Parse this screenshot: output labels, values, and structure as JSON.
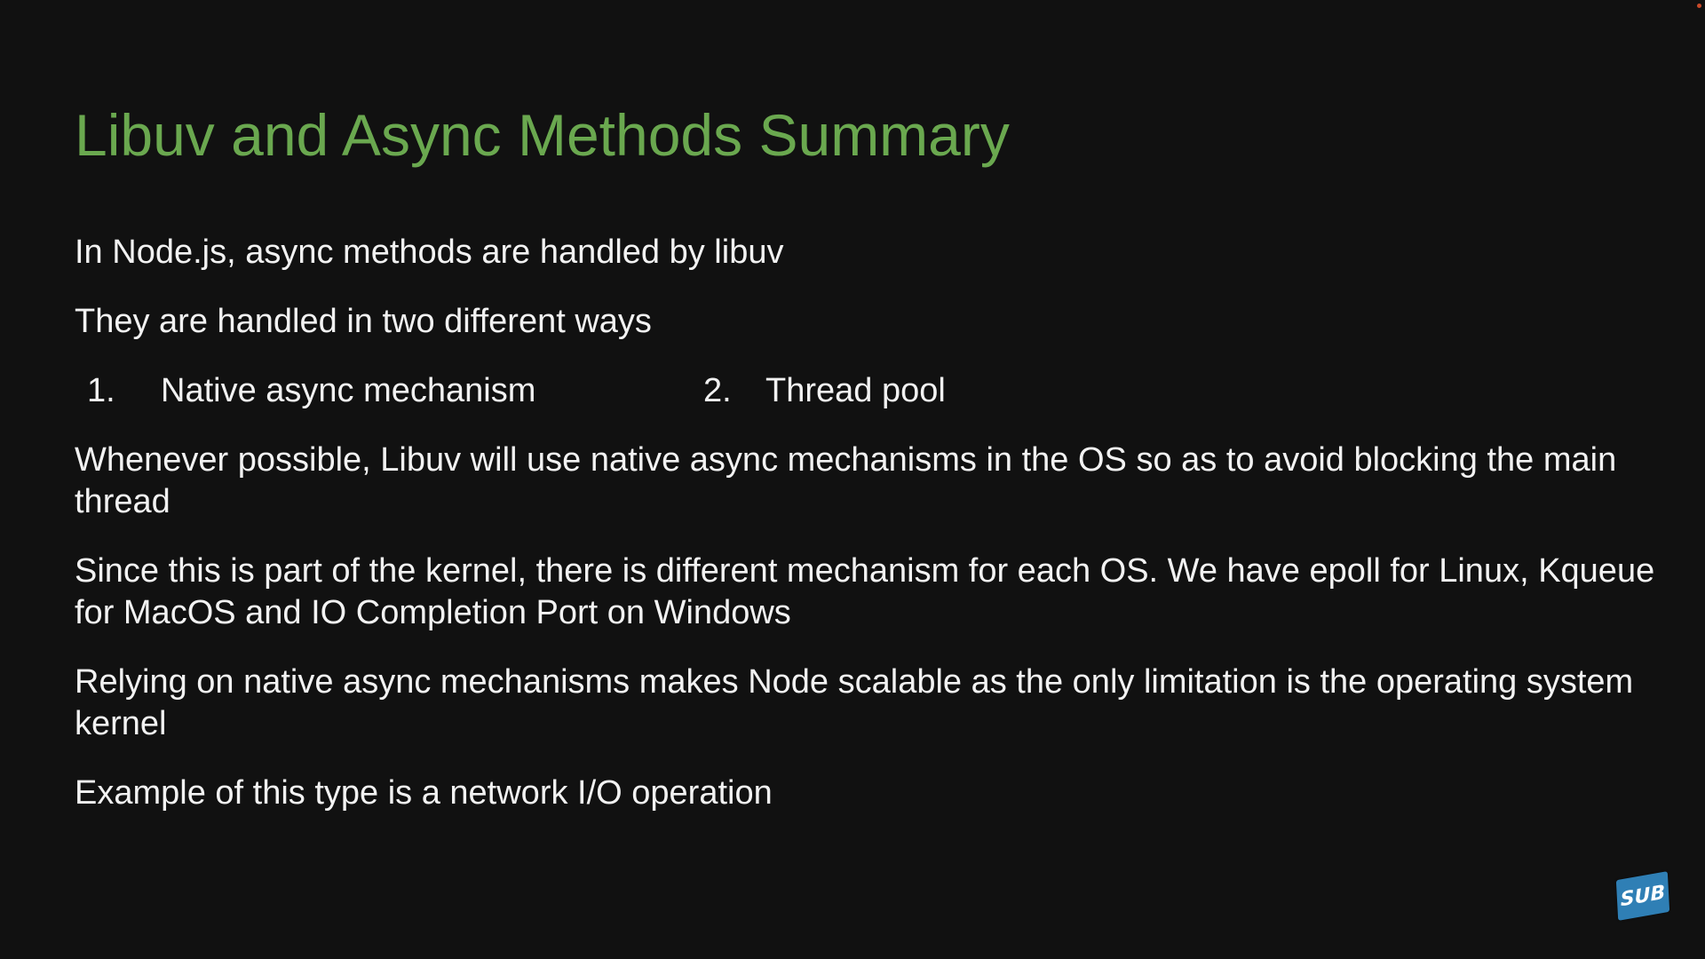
{
  "slide": {
    "title": "Libuv and Async Methods Summary",
    "paragraphs": [
      "In Node.js, async methods are handled by libuv",
      "They are handled in two different ways",
      "Whenever possible, Libuv will use native async mechanisms in the OS so as to avoid blocking the main thread",
      "Since this is part of the kernel, there is different mechanism for each OS. We have epoll for Linux, Kqueue for MacOS and IO Completion Port on Windows",
      "Relying on native async mechanisms makes Node scalable as the only limitation is the operating system kernel",
      "Example of this type is a network I/O operation"
    ],
    "list": [
      {
        "number": "1.",
        "text": "Native async mechanism"
      },
      {
        "number": "2.",
        "text": "Thread pool"
      }
    ]
  },
  "badge": {
    "label": "SUB",
    "icon": "subscribe-badge-icon"
  },
  "colors": {
    "background": "#111111",
    "title": "#6aa84f",
    "text": "#f2f2f2",
    "badge": "#2f7fb5"
  }
}
